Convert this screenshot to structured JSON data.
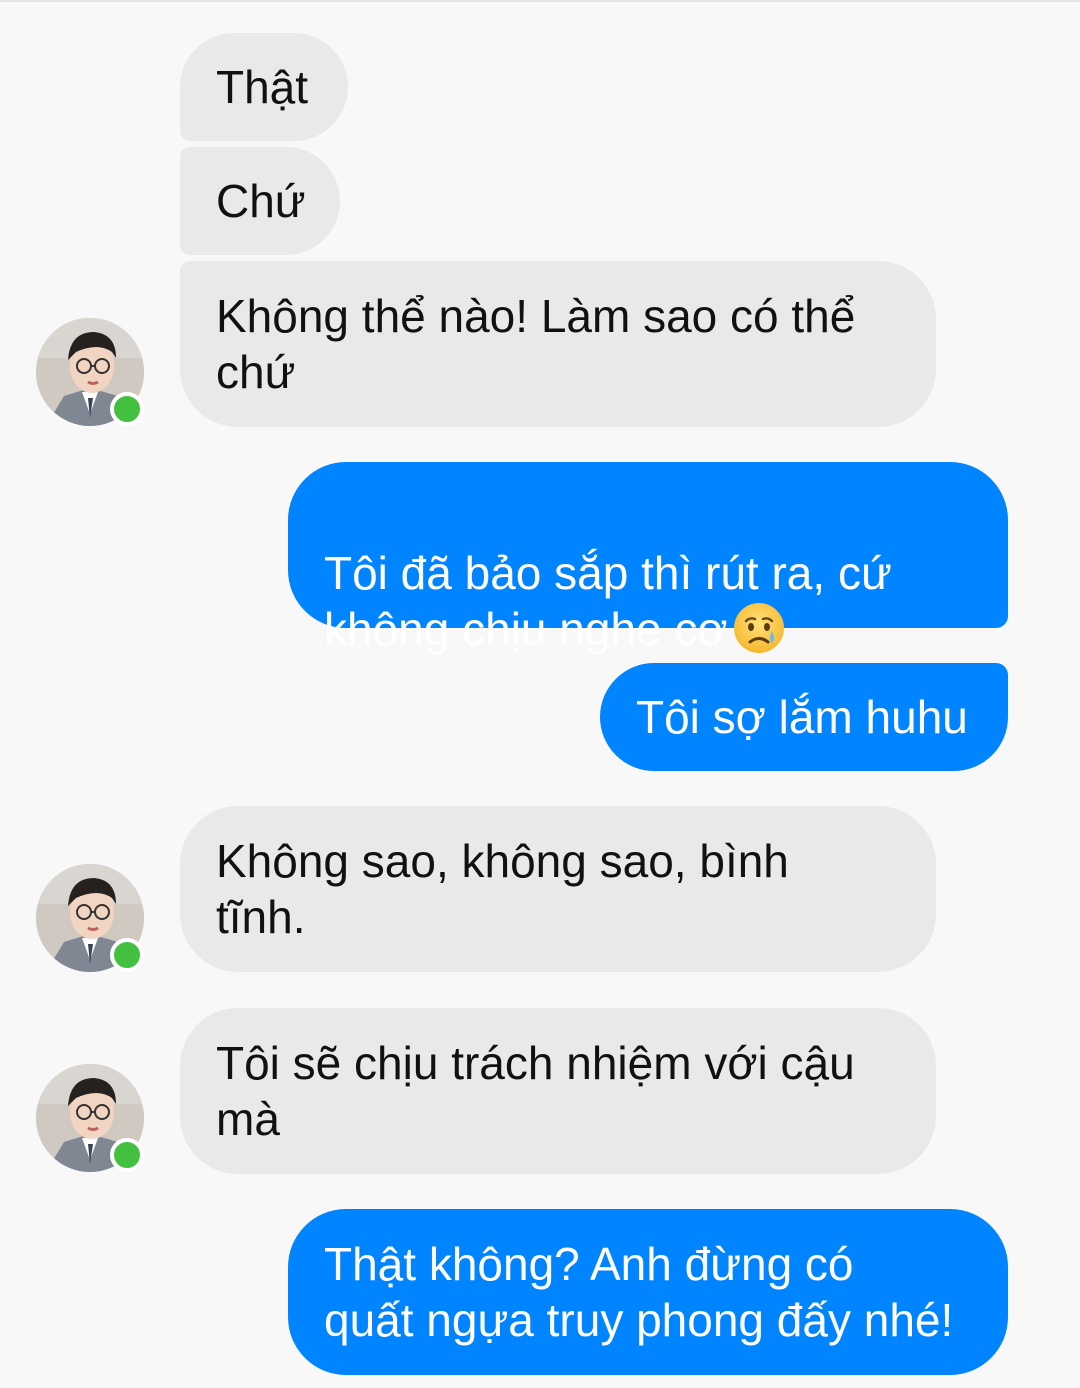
{
  "colors": {
    "incoming_bubble": "#e9e9e9",
    "outgoing_bubble": "#0084ff",
    "online_indicator": "#44c041",
    "background": "#f8f8f8"
  },
  "messages": [
    {
      "sender": "contact",
      "text": "Thật"
    },
    {
      "sender": "contact",
      "text": "Chứ"
    },
    {
      "sender": "contact",
      "text": "Không thể nào! Làm sao có thể\nchứ"
    },
    {
      "sender": "me",
      "text": "Tôi đã bảo sắp thì rút ra, cứ\nkhông chịu nghe cơ",
      "emoji": "sad-but-relieved-face-emoji"
    },
    {
      "sender": "me",
      "text": "Tôi sợ lắm huhu"
    },
    {
      "sender": "contact",
      "text": "Không sao, không sao, bình\ntĩnh."
    },
    {
      "sender": "contact",
      "text": "Tôi sẽ chịu trách nhiệm với cậu\nmà"
    },
    {
      "sender": "me",
      "text": "Thật không? Anh đừng có\nquất ngựa truy phong đấy nhé!"
    }
  ],
  "contact": {
    "avatar_icon": "contact-avatar",
    "status": "online"
  }
}
